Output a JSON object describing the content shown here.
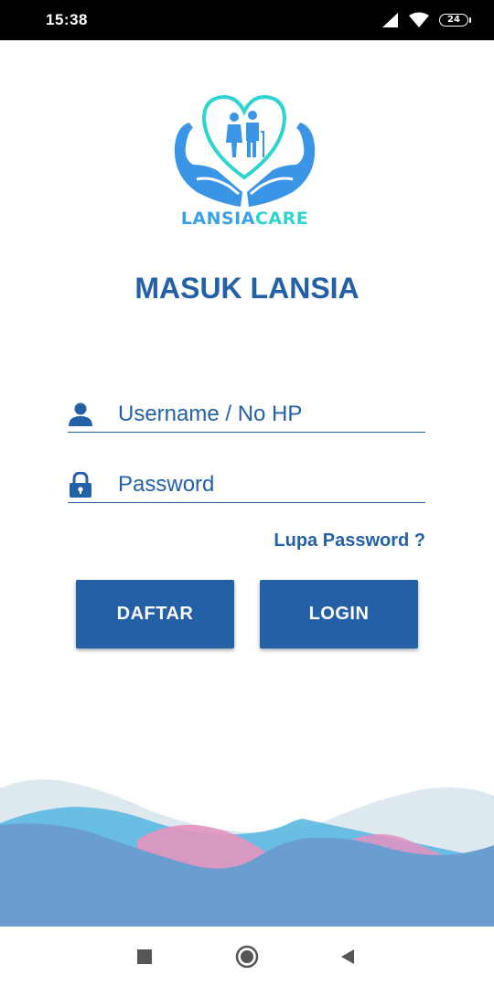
{
  "status_bar": {
    "time": "15:38",
    "battery_level": "24",
    "icons": [
      "signal-icon",
      "wifi-icon",
      "battery-icon"
    ]
  },
  "logo": {
    "word_1": "LANSIA",
    "word_2": "CARE"
  },
  "page_title": "MASUK LANSIA",
  "form": {
    "username": {
      "placeholder": "Username / No HP",
      "value": "",
      "icon": "user-icon"
    },
    "password": {
      "placeholder": "Password",
      "value": "",
      "icon": "lock-icon"
    }
  },
  "forgot_password_label": "Lupa Password ?",
  "buttons": {
    "daftar_label": "DAFTAR",
    "login_label": "LOGIN"
  },
  "nav_bar": {
    "icons": [
      "recents-icon",
      "home-icon",
      "back-icon"
    ]
  },
  "colors": {
    "primary": "#2360a5",
    "logo_blue": "#3aa0e8",
    "logo_teal": "#2fd4d0",
    "wave_pink": "#e393bf",
    "wave_light": "#dde8ef",
    "wave_mid": "#5bb8e0",
    "wave_dark": "#6a9ed0"
  }
}
